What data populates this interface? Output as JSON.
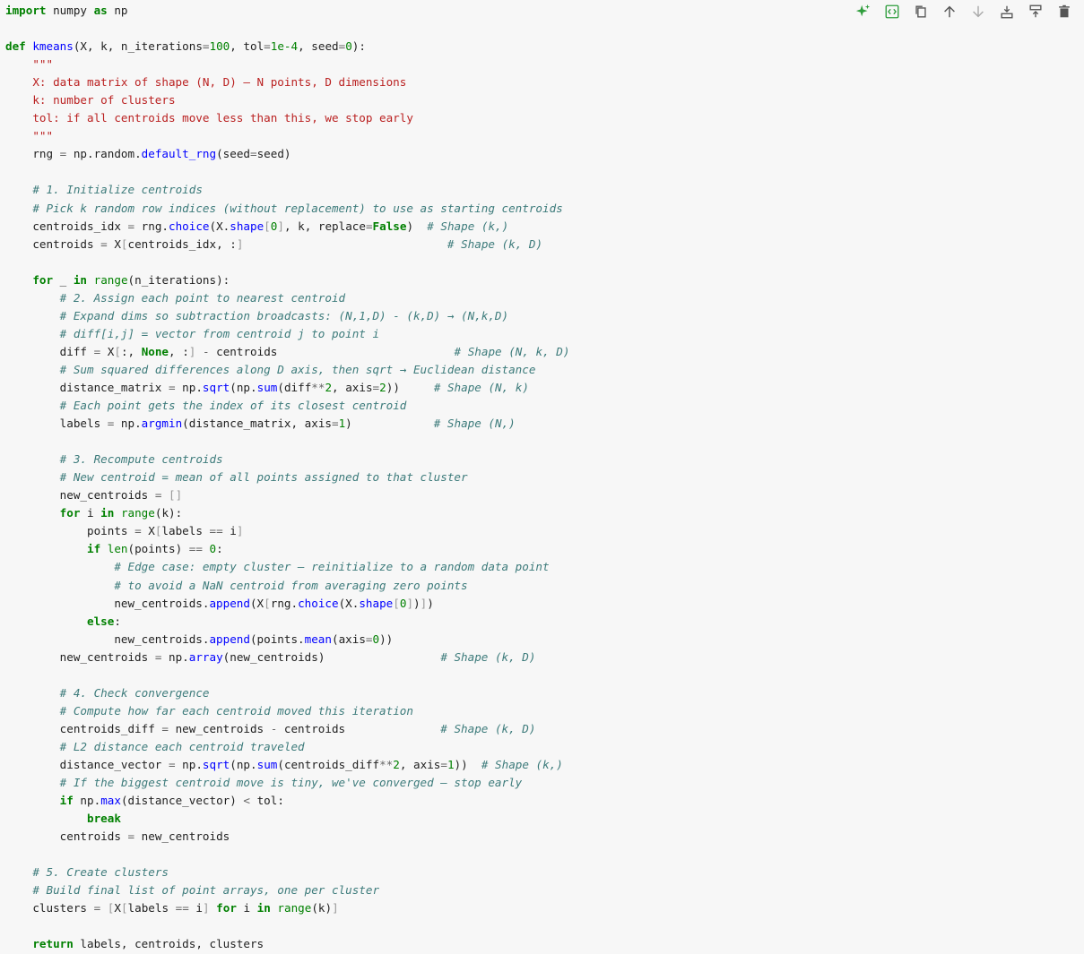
{
  "toolbar": {
    "buttons": [
      {
        "name": "ai-assist-button",
        "icon": "sparkle-icon",
        "color": "#2e9d3c"
      },
      {
        "name": "code-button",
        "icon": "code-brackets-icon",
        "color": "#2e9d3c"
      },
      {
        "name": "copy-button",
        "icon": "copy-icon",
        "color": "#555555"
      },
      {
        "name": "move-up-button",
        "icon": "arrow-up-icon",
        "color": "#555555"
      },
      {
        "name": "move-down-button",
        "icon": "arrow-down-icon",
        "color": "#aaaaaa"
      },
      {
        "name": "insert-below-button",
        "icon": "insert-below-icon",
        "color": "#555555"
      },
      {
        "name": "insert-above-button",
        "icon": "insert-above-icon",
        "color": "#555555"
      },
      {
        "name": "delete-button",
        "icon": "trash-icon",
        "color": "#555555"
      }
    ]
  },
  "code_lines": [
    [
      [
        "kw",
        "import"
      ],
      [
        "pl",
        " numpy "
      ],
      [
        "kw",
        "as"
      ],
      [
        "pl",
        " np"
      ]
    ],
    [],
    [
      [
        "kw",
        "def"
      ],
      [
        "pl",
        " "
      ],
      [
        "fn",
        "kmeans"
      ],
      [
        "pl",
        "(X, k, n_iterations"
      ],
      [
        "op",
        "="
      ],
      [
        "num",
        "100"
      ],
      [
        "pl",
        ", tol"
      ],
      [
        "op",
        "="
      ],
      [
        "num",
        "1e-4"
      ],
      [
        "pl",
        ", seed"
      ],
      [
        "op",
        "="
      ],
      [
        "num",
        "0"
      ],
      [
        "pl",
        "):"
      ]
    ],
    [
      [
        "pl",
        "    "
      ],
      [
        "str",
        "\"\"\""
      ]
    ],
    [
      [
        "str",
        "    X: data matrix of shape (N, D) — N points, D dimensions"
      ]
    ],
    [
      [
        "str",
        "    k: number of clusters"
      ]
    ],
    [
      [
        "str",
        "    tol: if all centroids move less than this, we stop early"
      ]
    ],
    [
      [
        "pl",
        "    "
      ],
      [
        "str",
        "\"\"\""
      ]
    ],
    [
      [
        "pl",
        "    rng "
      ],
      [
        "op",
        "="
      ],
      [
        "pl",
        " np.random."
      ],
      [
        "fn",
        "default_rng"
      ],
      [
        "pl",
        "(seed"
      ],
      [
        "op",
        "="
      ],
      [
        "pl",
        "seed)"
      ]
    ],
    [],
    [
      [
        "pl",
        "    "
      ],
      [
        "cm",
        "# 1. Initialize centroids"
      ]
    ],
    [
      [
        "pl",
        "    "
      ],
      [
        "cm",
        "# Pick k random row indices (without replacement) to use as starting centroids"
      ]
    ],
    [
      [
        "pl",
        "    centroids_idx "
      ],
      [
        "op",
        "="
      ],
      [
        "pl",
        " rng."
      ],
      [
        "fn",
        "choice"
      ],
      [
        "pl",
        "(X."
      ],
      [
        "fn",
        "shape"
      ],
      [
        "br",
        "["
      ],
      [
        "num",
        "0"
      ],
      [
        "br",
        "]"
      ],
      [
        "pl",
        ", k, replace"
      ],
      [
        "op",
        "="
      ],
      [
        "kw",
        "False"
      ],
      [
        "pl",
        ")  "
      ],
      [
        "cm",
        "# Shape (k,)"
      ]
    ],
    [
      [
        "pl",
        "    centroids "
      ],
      [
        "op",
        "="
      ],
      [
        "pl",
        " X"
      ],
      [
        "br",
        "["
      ],
      [
        "pl",
        "centroids_idx, :"
      ],
      [
        "br",
        "]"
      ],
      [
        "pl",
        "                              "
      ],
      [
        "cm",
        "# Shape (k, D)"
      ]
    ],
    [],
    [
      [
        "pl",
        "    "
      ],
      [
        "kw",
        "for"
      ],
      [
        "pl",
        " _ "
      ],
      [
        "kw",
        "in"
      ],
      [
        "pl",
        " "
      ],
      [
        "bi",
        "range"
      ],
      [
        "pl",
        "(n_iterations):"
      ]
    ],
    [
      [
        "pl",
        "        "
      ],
      [
        "cm",
        "# 2. Assign each point to nearest centroid"
      ]
    ],
    [
      [
        "pl",
        "        "
      ],
      [
        "cm",
        "# Expand dims so subtraction broadcasts: (N,1,D) - (k,D) → (N,k,D)"
      ]
    ],
    [
      [
        "pl",
        "        "
      ],
      [
        "cm",
        "# diff[i,j] = vector from centroid j to point i"
      ]
    ],
    [
      [
        "pl",
        "        diff "
      ],
      [
        "op",
        "="
      ],
      [
        "pl",
        " X"
      ],
      [
        "br",
        "["
      ],
      [
        "pl",
        ":, "
      ],
      [
        "kw",
        "None"
      ],
      [
        "pl",
        ", :"
      ],
      [
        "br",
        "]"
      ],
      [
        "pl",
        " "
      ],
      [
        "op",
        "-"
      ],
      [
        "pl",
        " centroids                          "
      ],
      [
        "cm",
        "# Shape (N, k, D)"
      ]
    ],
    [
      [
        "pl",
        "        "
      ],
      [
        "cm",
        "# Sum squared differences along D axis, then sqrt → Euclidean distance"
      ]
    ],
    [
      [
        "pl",
        "        distance_matrix "
      ],
      [
        "op",
        "="
      ],
      [
        "pl",
        " np."
      ],
      [
        "fn",
        "sqrt"
      ],
      [
        "pl",
        "(np."
      ],
      [
        "fn",
        "sum"
      ],
      [
        "pl",
        "(diff"
      ],
      [
        "op",
        "**"
      ],
      [
        "num",
        "2"
      ],
      [
        "pl",
        ", axis"
      ],
      [
        "op",
        "="
      ],
      [
        "num",
        "2"
      ],
      [
        "pl",
        "))     "
      ],
      [
        "cm",
        "# Shape (N, k)"
      ]
    ],
    [
      [
        "pl",
        "        "
      ],
      [
        "cm",
        "# Each point gets the index of its closest centroid"
      ]
    ],
    [
      [
        "pl",
        "        labels "
      ],
      [
        "op",
        "="
      ],
      [
        "pl",
        " np."
      ],
      [
        "fn",
        "argmin"
      ],
      [
        "pl",
        "(distance_matrix, axis"
      ],
      [
        "op",
        "="
      ],
      [
        "num",
        "1"
      ],
      [
        "pl",
        ")            "
      ],
      [
        "cm",
        "# Shape (N,)"
      ]
    ],
    [],
    [
      [
        "pl",
        "        "
      ],
      [
        "cm",
        "# 3. Recompute centroids"
      ]
    ],
    [
      [
        "pl",
        "        "
      ],
      [
        "cm",
        "# New centroid = mean of all points assigned to that cluster"
      ]
    ],
    [
      [
        "pl",
        "        new_centroids "
      ],
      [
        "op",
        "="
      ],
      [
        "pl",
        " "
      ],
      [
        "br",
        "[]"
      ]
    ],
    [
      [
        "pl",
        "        "
      ],
      [
        "kw",
        "for"
      ],
      [
        "pl",
        " i "
      ],
      [
        "kw",
        "in"
      ],
      [
        "pl",
        " "
      ],
      [
        "bi",
        "range"
      ],
      [
        "pl",
        "(k):"
      ]
    ],
    [
      [
        "pl",
        "            points "
      ],
      [
        "op",
        "="
      ],
      [
        "pl",
        " X"
      ],
      [
        "br",
        "["
      ],
      [
        "pl",
        "labels "
      ],
      [
        "op",
        "=="
      ],
      [
        "pl",
        " i"
      ],
      [
        "br",
        "]"
      ]
    ],
    [
      [
        "pl",
        "            "
      ],
      [
        "kw",
        "if"
      ],
      [
        "pl",
        " "
      ],
      [
        "bi",
        "len"
      ],
      [
        "pl",
        "(points) "
      ],
      [
        "op",
        "=="
      ],
      [
        "pl",
        " "
      ],
      [
        "num",
        "0"
      ],
      [
        "pl",
        ":"
      ]
    ],
    [
      [
        "pl",
        "                "
      ],
      [
        "cm",
        "# Edge case: empty cluster — reinitialize to a random data point"
      ]
    ],
    [
      [
        "pl",
        "                "
      ],
      [
        "cm",
        "# to avoid a NaN centroid from averaging zero points"
      ]
    ],
    [
      [
        "pl",
        "                new_centroids."
      ],
      [
        "fn",
        "append"
      ],
      [
        "pl",
        "(X"
      ],
      [
        "br",
        "["
      ],
      [
        "pl",
        "rng."
      ],
      [
        "fn",
        "choice"
      ],
      [
        "pl",
        "(X."
      ],
      [
        "fn",
        "shape"
      ],
      [
        "br",
        "["
      ],
      [
        "num",
        "0"
      ],
      [
        "br",
        "]"
      ],
      [
        "pl",
        ")"
      ],
      [
        "br",
        "]"
      ],
      [
        "pl",
        ")"
      ]
    ],
    [
      [
        "pl",
        "            "
      ],
      [
        "kw",
        "else"
      ],
      [
        "pl",
        ":"
      ]
    ],
    [
      [
        "pl",
        "                new_centroids."
      ],
      [
        "fn",
        "append"
      ],
      [
        "pl",
        "(points."
      ],
      [
        "fn",
        "mean"
      ],
      [
        "pl",
        "(axis"
      ],
      [
        "op",
        "="
      ],
      [
        "num",
        "0"
      ],
      [
        "pl",
        "))"
      ]
    ],
    [
      [
        "pl",
        "        new_centroids "
      ],
      [
        "op",
        "="
      ],
      [
        "pl",
        " np."
      ],
      [
        "fn",
        "array"
      ],
      [
        "pl",
        "(new_centroids)                 "
      ],
      [
        "cm",
        "# Shape (k, D)"
      ]
    ],
    [],
    [
      [
        "pl",
        "        "
      ],
      [
        "cm",
        "# 4. Check convergence"
      ]
    ],
    [
      [
        "pl",
        "        "
      ],
      [
        "cm",
        "# Compute how far each centroid moved this iteration"
      ]
    ],
    [
      [
        "pl",
        "        centroids_diff "
      ],
      [
        "op",
        "="
      ],
      [
        "pl",
        " new_centroids "
      ],
      [
        "op",
        "-"
      ],
      [
        "pl",
        " centroids              "
      ],
      [
        "cm",
        "# Shape (k, D)"
      ]
    ],
    [
      [
        "pl",
        "        "
      ],
      [
        "cm",
        "# L2 distance each centroid traveled"
      ]
    ],
    [
      [
        "pl",
        "        distance_vector "
      ],
      [
        "op",
        "="
      ],
      [
        "pl",
        " np."
      ],
      [
        "fn",
        "sqrt"
      ],
      [
        "pl",
        "(np."
      ],
      [
        "fn",
        "sum"
      ],
      [
        "pl",
        "(centroids_diff"
      ],
      [
        "op",
        "**"
      ],
      [
        "num",
        "2"
      ],
      [
        "pl",
        ", axis"
      ],
      [
        "op",
        "="
      ],
      [
        "num",
        "1"
      ],
      [
        "pl",
        "))  "
      ],
      [
        "cm",
        "# Shape (k,)"
      ]
    ],
    [
      [
        "pl",
        "        "
      ],
      [
        "cm",
        "# If the biggest centroid move is tiny, we've converged — stop early"
      ]
    ],
    [
      [
        "pl",
        "        "
      ],
      [
        "kw",
        "if"
      ],
      [
        "pl",
        " np."
      ],
      [
        "fn",
        "max"
      ],
      [
        "pl",
        "(distance_vector) "
      ],
      [
        "op",
        "<"
      ],
      [
        "pl",
        " tol:"
      ]
    ],
    [
      [
        "pl",
        "            "
      ],
      [
        "kw",
        "break"
      ]
    ],
    [
      [
        "pl",
        "        centroids "
      ],
      [
        "op",
        "="
      ],
      [
        "pl",
        " new_centroids"
      ]
    ],
    [],
    [
      [
        "pl",
        "    "
      ],
      [
        "cm",
        "# 5. Create clusters"
      ]
    ],
    [
      [
        "pl",
        "    "
      ],
      [
        "cm",
        "# Build final list of point arrays, one per cluster"
      ]
    ],
    [
      [
        "pl",
        "    clusters "
      ],
      [
        "op",
        "="
      ],
      [
        "pl",
        " "
      ],
      [
        "br",
        "["
      ],
      [
        "pl",
        "X"
      ],
      [
        "br",
        "["
      ],
      [
        "pl",
        "labels "
      ],
      [
        "op",
        "=="
      ],
      [
        "pl",
        " i"
      ],
      [
        "br",
        "]"
      ],
      [
        "pl",
        " "
      ],
      [
        "kw",
        "for"
      ],
      [
        "pl",
        " i "
      ],
      [
        "kw",
        "in"
      ],
      [
        "pl",
        " "
      ],
      [
        "bi",
        "range"
      ],
      [
        "pl",
        "(k)"
      ],
      [
        "br",
        "]"
      ]
    ],
    [],
    [
      [
        "pl",
        "    "
      ],
      [
        "kw",
        "return"
      ],
      [
        "pl",
        " labels, centroids, clusters"
      ]
    ]
  ]
}
